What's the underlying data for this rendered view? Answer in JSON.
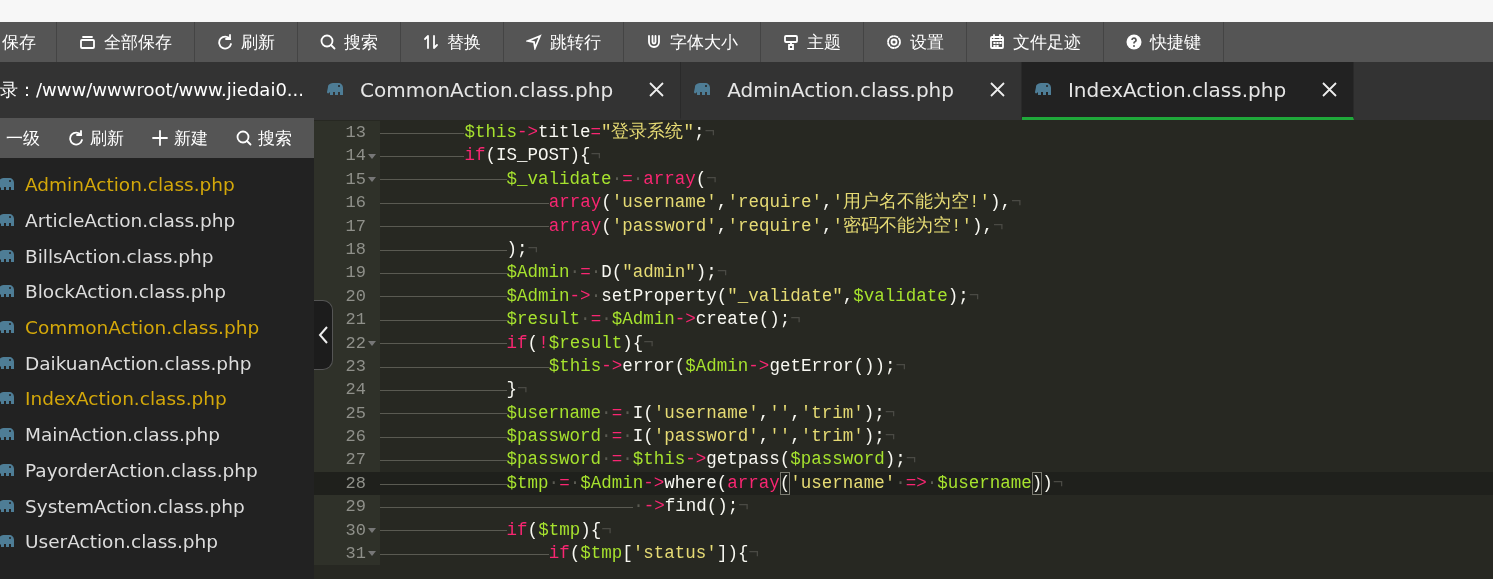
{
  "toolbar": [
    {
      "kind": "save",
      "label": "保存"
    },
    {
      "kind": "save-all",
      "label": "全部保存"
    },
    {
      "kind": "refresh",
      "label": "刷新"
    },
    {
      "kind": "search",
      "label": "搜索"
    },
    {
      "kind": "replace",
      "label": "替换"
    },
    {
      "kind": "goto",
      "label": "跳转行"
    },
    {
      "kind": "font",
      "label": "字体大小"
    },
    {
      "kind": "theme",
      "label": "主题"
    },
    {
      "kind": "settings",
      "label": "设置"
    },
    {
      "kind": "history",
      "label": "文件足迹"
    },
    {
      "kind": "help",
      "label": "快捷键"
    }
  ],
  "sidebar": {
    "path": "录：/www/wwwroot/www.jiedai0...",
    "tools": [
      {
        "kind": "up",
        "label": "一级"
      },
      {
        "kind": "refresh",
        "label": "刷新"
      },
      {
        "kind": "new",
        "label": "新建"
      },
      {
        "kind": "search",
        "label": "搜索"
      }
    ],
    "files": [
      {
        "name": "AdminAction.class.php",
        "open": true
      },
      {
        "name": "ArticleAction.class.php",
        "open": false
      },
      {
        "name": "BillsAction.class.php",
        "open": false
      },
      {
        "name": "BlockAction.class.php",
        "open": false
      },
      {
        "name": "CommonAction.class.php",
        "open": true
      },
      {
        "name": "DaikuanAction.class.php",
        "open": false
      },
      {
        "name": "IndexAction.class.php",
        "open": true
      },
      {
        "name": "MainAction.class.php",
        "open": false
      },
      {
        "name": "PayorderAction.class.php",
        "open": false
      },
      {
        "name": "SystemAction.class.php",
        "open": false
      },
      {
        "name": "UserAction.class.php",
        "open": false
      }
    ]
  },
  "tabs": [
    {
      "label": "CommonAction.class.php",
      "selected": false
    },
    {
      "label": "AdminAction.class.php",
      "selected": false
    },
    {
      "label": "IndexAction.class.php",
      "selected": true
    }
  ],
  "editor": {
    "lines": [
      {
        "number": "13",
        "fold": false,
        "current": false,
        "tokens": [
          {
            "kind": "tab"
          },
          {
            "kind": "tab"
          },
          {
            "kind": "var",
            "text": "$this"
          },
          {
            "kind": "op",
            "text": "->"
          },
          {
            "kind": "plain",
            "text": "title"
          },
          {
            "kind": "op",
            "text": "="
          },
          {
            "kind": "str",
            "text": "\"登录系统\""
          },
          {
            "kind": "plain",
            "text": ";"
          },
          {
            "kind": "eol",
            "text": "¬"
          }
        ]
      },
      {
        "number": "14",
        "fold": true,
        "current": false,
        "tokens": [
          {
            "kind": "tab"
          },
          {
            "kind": "tab"
          },
          {
            "kind": "kw",
            "text": "if"
          },
          {
            "kind": "plain",
            "text": "(IS_POST){"
          },
          {
            "kind": "eol",
            "text": "¬"
          }
        ]
      },
      {
        "number": "15",
        "fold": true,
        "current": false,
        "tokens": [
          {
            "kind": "tab"
          },
          {
            "kind": "tab"
          },
          {
            "kind": "tab"
          },
          {
            "kind": "var",
            "text": "$_validate"
          },
          {
            "kind": "space",
            "text": "·"
          },
          {
            "kind": "op",
            "text": "="
          },
          {
            "kind": "space",
            "text": "·"
          },
          {
            "kind": "kw",
            "text": "array"
          },
          {
            "kind": "plain",
            "text": "("
          },
          {
            "kind": "eol",
            "text": "¬"
          }
        ]
      },
      {
        "number": "16",
        "fold": false,
        "current": false,
        "tokens": [
          {
            "kind": "tab"
          },
          {
            "kind": "tab"
          },
          {
            "kind": "tab"
          },
          {
            "kind": "tab"
          },
          {
            "kind": "kw",
            "text": "array"
          },
          {
            "kind": "plain",
            "text": "("
          },
          {
            "kind": "str",
            "text": "'username'"
          },
          {
            "kind": "plain",
            "text": ","
          },
          {
            "kind": "str",
            "text": "'require'"
          },
          {
            "kind": "plain",
            "text": ","
          },
          {
            "kind": "str",
            "text": "'用户名不能为空!'"
          },
          {
            "kind": "plain",
            "text": "),"
          },
          {
            "kind": "eol",
            "text": "¬"
          }
        ]
      },
      {
        "number": "17",
        "fold": false,
        "current": false,
        "tokens": [
          {
            "kind": "tab"
          },
          {
            "kind": "tab"
          },
          {
            "kind": "tab"
          },
          {
            "kind": "tab"
          },
          {
            "kind": "kw",
            "text": "array"
          },
          {
            "kind": "plain",
            "text": "("
          },
          {
            "kind": "str",
            "text": "'password'"
          },
          {
            "kind": "plain",
            "text": ","
          },
          {
            "kind": "str",
            "text": "'require'"
          },
          {
            "kind": "plain",
            "text": ","
          },
          {
            "kind": "str",
            "text": "'密码不能为空!'"
          },
          {
            "kind": "plain",
            "text": "),"
          },
          {
            "kind": "eol",
            "text": "¬"
          }
        ]
      },
      {
        "number": "18",
        "fold": false,
        "current": false,
        "tokens": [
          {
            "kind": "tab"
          },
          {
            "kind": "tab"
          },
          {
            "kind": "tab"
          },
          {
            "kind": "plain",
            "text": ");"
          },
          {
            "kind": "eol",
            "text": "¬"
          }
        ]
      },
      {
        "number": "19",
        "fold": false,
        "current": false,
        "tokens": [
          {
            "kind": "tab"
          },
          {
            "kind": "tab"
          },
          {
            "kind": "tab"
          },
          {
            "kind": "var",
            "text": "$Admin"
          },
          {
            "kind": "space",
            "text": "·"
          },
          {
            "kind": "op",
            "text": "="
          },
          {
            "kind": "space",
            "text": "·"
          },
          {
            "kind": "plain",
            "text": "D("
          },
          {
            "kind": "str",
            "text": "\"admin\""
          },
          {
            "kind": "plain",
            "text": ");"
          },
          {
            "kind": "eol",
            "text": "¬"
          }
        ]
      },
      {
        "number": "20",
        "fold": false,
        "current": false,
        "tokens": [
          {
            "kind": "tab"
          },
          {
            "kind": "tab"
          },
          {
            "kind": "tab"
          },
          {
            "kind": "var",
            "text": "$Admin"
          },
          {
            "kind": "op",
            "text": "->"
          },
          {
            "kind": "space",
            "text": "·"
          },
          {
            "kind": "plain",
            "text": "setProperty("
          },
          {
            "kind": "str",
            "text": "\"_validate\""
          },
          {
            "kind": "plain",
            "text": ","
          },
          {
            "kind": "var",
            "text": "$validate"
          },
          {
            "kind": "plain",
            "text": ");"
          },
          {
            "kind": "eol",
            "text": "¬"
          }
        ]
      },
      {
        "number": "21",
        "fold": false,
        "current": false,
        "tokens": [
          {
            "kind": "tab"
          },
          {
            "kind": "tab"
          },
          {
            "kind": "tab"
          },
          {
            "kind": "var",
            "text": "$result"
          },
          {
            "kind": "space",
            "text": "·"
          },
          {
            "kind": "op",
            "text": "="
          },
          {
            "kind": "space",
            "text": "·"
          },
          {
            "kind": "var",
            "text": "$Admin"
          },
          {
            "kind": "op",
            "text": "->"
          },
          {
            "kind": "plain",
            "text": "create();"
          },
          {
            "kind": "eol",
            "text": "¬"
          }
        ]
      },
      {
        "number": "22",
        "fold": true,
        "current": false,
        "tokens": [
          {
            "kind": "tab"
          },
          {
            "kind": "tab"
          },
          {
            "kind": "tab"
          },
          {
            "kind": "kw",
            "text": "if"
          },
          {
            "kind": "plain",
            "text": "("
          },
          {
            "kind": "op",
            "text": "!"
          },
          {
            "kind": "var",
            "text": "$result"
          },
          {
            "kind": "plain",
            "text": "){"
          },
          {
            "kind": "eol",
            "text": "¬"
          }
        ]
      },
      {
        "number": "23",
        "fold": false,
        "current": false,
        "tokens": [
          {
            "kind": "tab"
          },
          {
            "kind": "tab"
          },
          {
            "kind": "tab"
          },
          {
            "kind": "tab"
          },
          {
            "kind": "var",
            "text": "$this"
          },
          {
            "kind": "op",
            "text": "->"
          },
          {
            "kind": "plain",
            "text": "error("
          },
          {
            "kind": "var",
            "text": "$Admin"
          },
          {
            "kind": "op",
            "text": "->"
          },
          {
            "kind": "plain",
            "text": "getError());"
          },
          {
            "kind": "eol",
            "text": "¬"
          }
        ]
      },
      {
        "number": "24",
        "fold": false,
        "current": false,
        "tokens": [
          {
            "kind": "tab"
          },
          {
            "kind": "tab"
          },
          {
            "kind": "tab"
          },
          {
            "kind": "plain",
            "text": "}"
          },
          {
            "kind": "eol",
            "text": "¬"
          }
        ]
      },
      {
        "number": "25",
        "fold": false,
        "current": false,
        "tokens": [
          {
            "kind": "tab"
          },
          {
            "kind": "tab"
          },
          {
            "kind": "tab"
          },
          {
            "kind": "var",
            "text": "$username"
          },
          {
            "kind": "space",
            "text": "·"
          },
          {
            "kind": "op",
            "text": "="
          },
          {
            "kind": "space",
            "text": "·"
          },
          {
            "kind": "plain",
            "text": "I("
          },
          {
            "kind": "str",
            "text": "'username'"
          },
          {
            "kind": "plain",
            "text": ","
          },
          {
            "kind": "str",
            "text": "''"
          },
          {
            "kind": "plain",
            "text": ","
          },
          {
            "kind": "str",
            "text": "'trim'"
          },
          {
            "kind": "plain",
            "text": ");"
          },
          {
            "kind": "eol",
            "text": "¬"
          }
        ]
      },
      {
        "number": "26",
        "fold": false,
        "current": false,
        "tokens": [
          {
            "kind": "tab"
          },
          {
            "kind": "tab"
          },
          {
            "kind": "tab"
          },
          {
            "kind": "var",
            "text": "$password"
          },
          {
            "kind": "space",
            "text": "·"
          },
          {
            "kind": "op",
            "text": "="
          },
          {
            "kind": "space",
            "text": "·"
          },
          {
            "kind": "plain",
            "text": "I("
          },
          {
            "kind": "str",
            "text": "'password'"
          },
          {
            "kind": "plain",
            "text": ","
          },
          {
            "kind": "str",
            "text": "''"
          },
          {
            "kind": "plain",
            "text": ","
          },
          {
            "kind": "str",
            "text": "'trim'"
          },
          {
            "kind": "plain",
            "text": ");"
          },
          {
            "kind": "eol",
            "text": "¬"
          }
        ]
      },
      {
        "number": "27",
        "fold": false,
        "current": false,
        "tokens": [
          {
            "kind": "tab"
          },
          {
            "kind": "tab"
          },
          {
            "kind": "tab"
          },
          {
            "kind": "var",
            "text": "$password"
          },
          {
            "kind": "space",
            "text": "·"
          },
          {
            "kind": "op",
            "text": "="
          },
          {
            "kind": "space",
            "text": "·"
          },
          {
            "kind": "var",
            "text": "$this"
          },
          {
            "kind": "op",
            "text": "->"
          },
          {
            "kind": "plain",
            "text": "getpass("
          },
          {
            "kind": "var",
            "text": "$password"
          },
          {
            "kind": "plain",
            "text": ");"
          },
          {
            "kind": "eol",
            "text": "¬"
          }
        ]
      },
      {
        "number": "28",
        "fold": false,
        "current": true,
        "tokens": [
          {
            "kind": "tab"
          },
          {
            "kind": "tab"
          },
          {
            "kind": "tab"
          },
          {
            "kind": "var",
            "text": "$tmp"
          },
          {
            "kind": "space",
            "text": "·"
          },
          {
            "kind": "op",
            "text": "="
          },
          {
            "kind": "space",
            "text": "·"
          },
          {
            "kind": "var",
            "text": "$Admin"
          },
          {
            "kind": "op",
            "text": "->"
          },
          {
            "kind": "plain",
            "text": "where("
          },
          {
            "kind": "kw",
            "text": "array"
          },
          {
            "kind": "match",
            "text": "("
          },
          {
            "kind": "str",
            "text": "'username'"
          },
          {
            "kind": "space",
            "text": "·"
          },
          {
            "kind": "op",
            "text": "=>"
          },
          {
            "kind": "space",
            "text": "·"
          },
          {
            "kind": "var",
            "text": "$username"
          },
          {
            "kind": "match",
            "text": ")"
          },
          {
            "kind": "plain",
            "text": ")"
          },
          {
            "kind": "eol",
            "text": "¬"
          }
        ]
      },
      {
        "number": "29",
        "fold": false,
        "current": false,
        "tokens": [
          {
            "kind": "tab"
          },
          {
            "kind": "tab"
          },
          {
            "kind": "tab"
          },
          {
            "kind": "tab"
          },
          {
            "kind": "tab"
          },
          {
            "kind": "tab"
          },
          {
            "kind": "space",
            "text": "·"
          },
          {
            "kind": "op",
            "text": "->"
          },
          {
            "kind": "plain",
            "text": "find();"
          },
          {
            "kind": "eol",
            "text": "¬"
          }
        ]
      },
      {
        "number": "30",
        "fold": true,
        "current": false,
        "tokens": [
          {
            "kind": "tab"
          },
          {
            "kind": "tab"
          },
          {
            "kind": "tab"
          },
          {
            "kind": "kw",
            "text": "if"
          },
          {
            "kind": "plain",
            "text": "("
          },
          {
            "kind": "var",
            "text": "$tmp"
          },
          {
            "kind": "plain",
            "text": "){"
          },
          {
            "kind": "eol",
            "text": "¬"
          }
        ]
      },
      {
        "number": "31",
        "fold": true,
        "current": false,
        "tokens": [
          {
            "kind": "tab"
          },
          {
            "kind": "tab"
          },
          {
            "kind": "tab"
          },
          {
            "kind": "tab"
          },
          {
            "kind": "kw",
            "text": "if"
          },
          {
            "kind": "plain",
            "text": "("
          },
          {
            "kind": "var",
            "text": "$tmp"
          },
          {
            "kind": "plain",
            "text": "["
          },
          {
            "kind": "str",
            "text": "'status'"
          },
          {
            "kind": "plain",
            "text": "]){"
          },
          {
            "kind": "eol",
            "text": "¬"
          }
        ]
      }
    ]
  }
}
